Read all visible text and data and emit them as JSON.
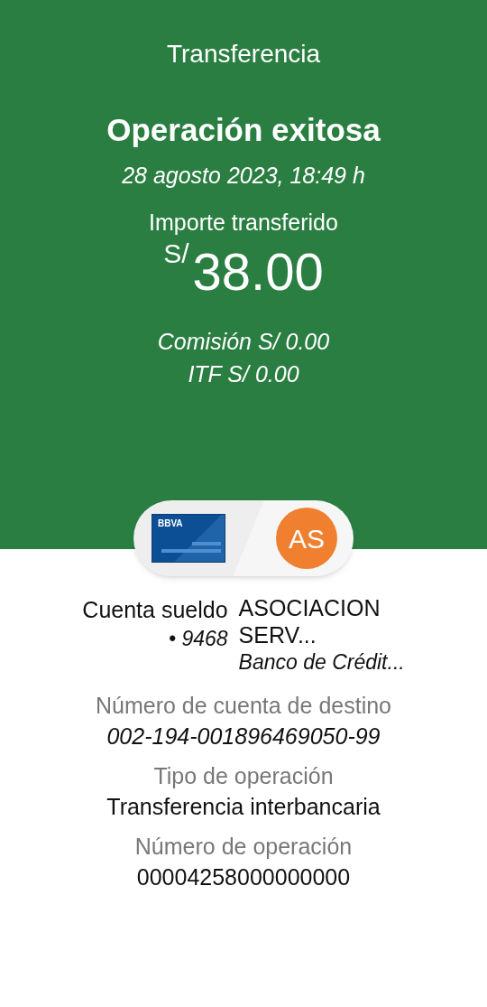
{
  "header": {
    "title": "Transferencia"
  },
  "result": {
    "status": "Operación exitosa",
    "datetime": "28 agosto 2023,  18:49 h",
    "amount_label": "Importe transferido",
    "currency": "S/",
    "amount": "38.00",
    "fees": [
      {
        "label": "Comisión",
        "value": "S/ 0.00"
      },
      {
        "label": "ITF",
        "value": "S/ 0.00"
      }
    ]
  },
  "transfer": {
    "origin": {
      "card_brand": "BBVA",
      "account": "Cuenta sueldo",
      "number": "• 9468"
    },
    "destination": {
      "initials": "AS",
      "name_lines": [
        "ASOCIACION",
        "SERV..."
      ],
      "bank": "Banco de Crédit..."
    }
  },
  "details": [
    {
      "label": "Número de cuenta de destino",
      "value": "002-194-001896469050-99",
      "italic": true
    },
    {
      "label": "Tipo de operación",
      "value": "Transferencia interbancaria",
      "italic": false
    },
    {
      "label": "Número de operación",
      "value": "00004258000000000",
      "italic": false
    }
  ]
}
